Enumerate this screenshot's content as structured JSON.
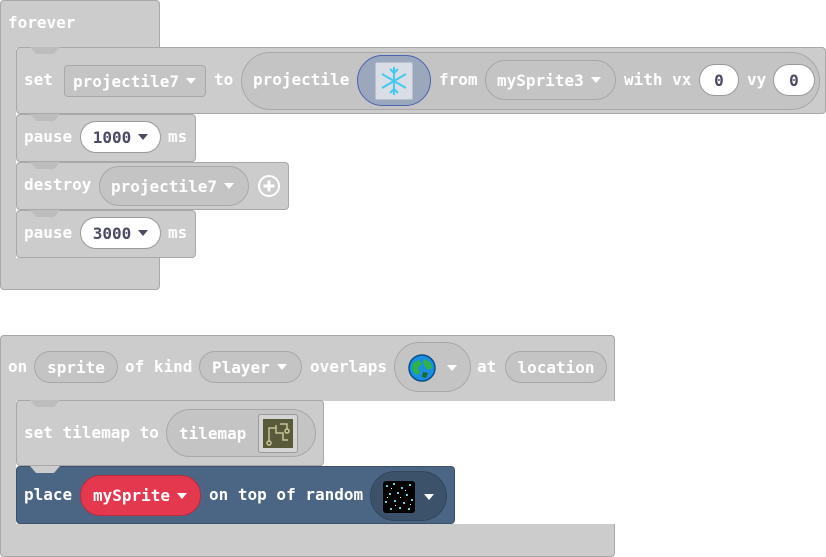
{
  "colors": {
    "block_gray": "#cccccc",
    "block_border": "#a8a8a8",
    "pill_gray": "#c4c4c4",
    "place_block": "#4b6584",
    "sprite_pill": "#e4384f",
    "image_field_bg": "#9aa7bc"
  },
  "forever_block": {
    "label": "forever",
    "set_stmt": {
      "set": "set",
      "variable": "projectile7",
      "to": "to",
      "projectile": "projectile",
      "image_icon": "snowflake-projectile-image",
      "from": "from",
      "source": "mySprite3",
      "with_vx": "with vx",
      "vx": "0",
      "vy_label": "vy",
      "vy": "0"
    },
    "pause1": {
      "label": "pause",
      "value": "1000",
      "unit": "ms"
    },
    "destroy": {
      "label": "destroy",
      "target": "projectile7",
      "add_icon": "plus-circle-icon"
    },
    "pause2": {
      "label": "pause",
      "value": "3000",
      "unit": "ms"
    }
  },
  "overlap_block": {
    "on": "on",
    "sprite": "sprite",
    "of_kind": "of kind",
    "kind": "Player",
    "overlaps": "overlaps",
    "tile_icon": "globe-tile-image",
    "at": "at",
    "location": "location",
    "set_tilemap": {
      "label": "set tilemap to",
      "tilemap": "tilemap",
      "tilemap_icon": "tilemap-thumbnail-image"
    },
    "place": {
      "place": "place",
      "sprite": "mySprite",
      "on_top": "on top of random",
      "tile_icon": "starfield-tile-image"
    }
  }
}
